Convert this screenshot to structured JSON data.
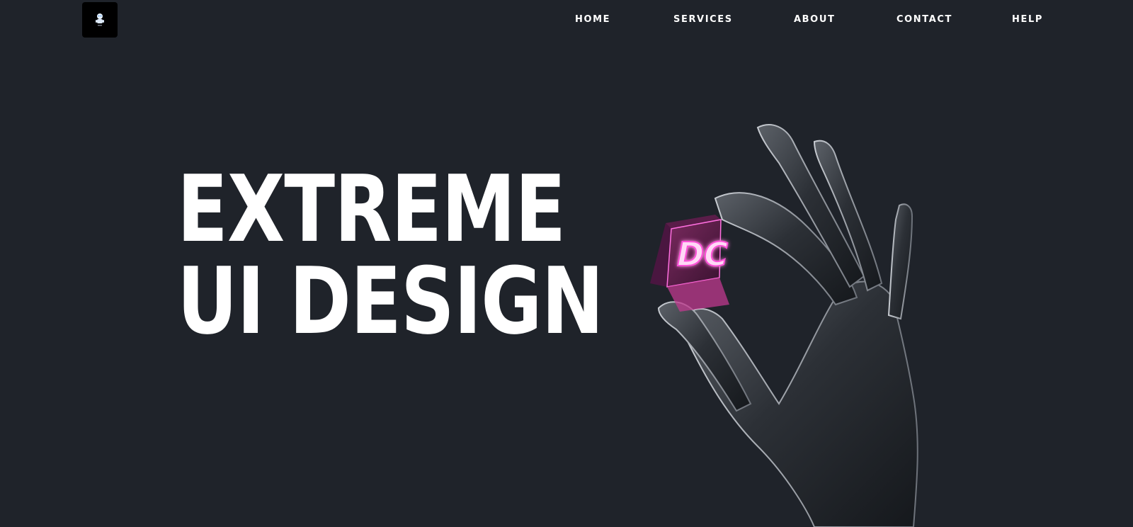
{
  "header": {
    "logo_alt": "site logo",
    "nav": [
      {
        "label": "HOME"
      },
      {
        "label": "SERVICES"
      },
      {
        "label": "ABOUT"
      },
      {
        "label": "CONTACT"
      },
      {
        "label": "HELP"
      }
    ]
  },
  "hero": {
    "title_line1": "EXTREME",
    "title_line2": "UI DESIGN",
    "cube_text": "DC",
    "accent_color": "#ff4fd8"
  },
  "colors": {
    "background": "#1f232a",
    "text": "#ffffff"
  }
}
